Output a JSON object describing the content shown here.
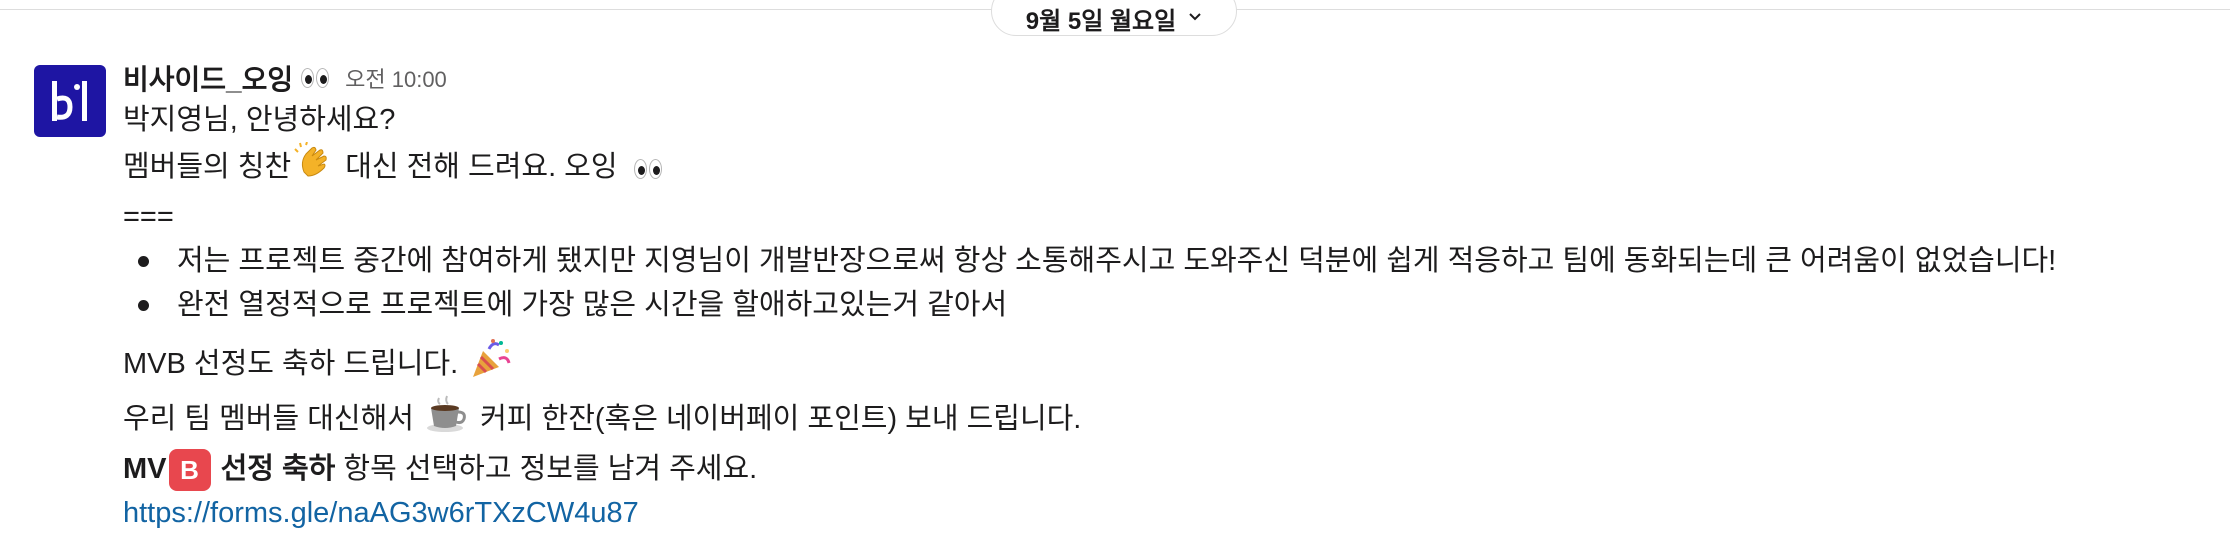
{
  "date_divider": {
    "label": "9월 5일 월요일",
    "chevron_icon": "chevron-down-icon"
  },
  "message": {
    "sender": "비사이드_오잉",
    "timestamp": "오전 10:00",
    "avatar_color": "#1e15a3",
    "greeting": "박지영님, 안녕하세요?",
    "intro_before": "멤버들의 칭찬",
    "intro_after": " 대신 전해 드려요. 오잉",
    "separator": "===",
    "bullets": [
      "저는 프로젝트 중간에 참여하게 됐지만 지영님이 개발반장으로써 항상 소통해주시고 도와주신 덕분에 쉽게 적응하고 팀에 동화되는데 큰 어려움이 없었습니다!",
      "완전 열정적으로 프로젝트에 가장 많은 시간을 할애하고있는거 같아서"
    ],
    "congrats": "MVB 선정도 축하 드립니다.",
    "coffee_before": "우리 팀 멤버들 대신해서",
    "coffee_after": "커피 한잔(혹은 네이버페이 포인트) 보내 드립니다.",
    "cta_prefix": "MV",
    "cta_badge": "B",
    "cta_bold": "선정 축하",
    "cta_rest": " 항목 선택하고 정보를 남겨 주세요.",
    "link": "https://forms.gle/naAG3w6rTXzCW4u87",
    "link_color": "#1264a3"
  }
}
